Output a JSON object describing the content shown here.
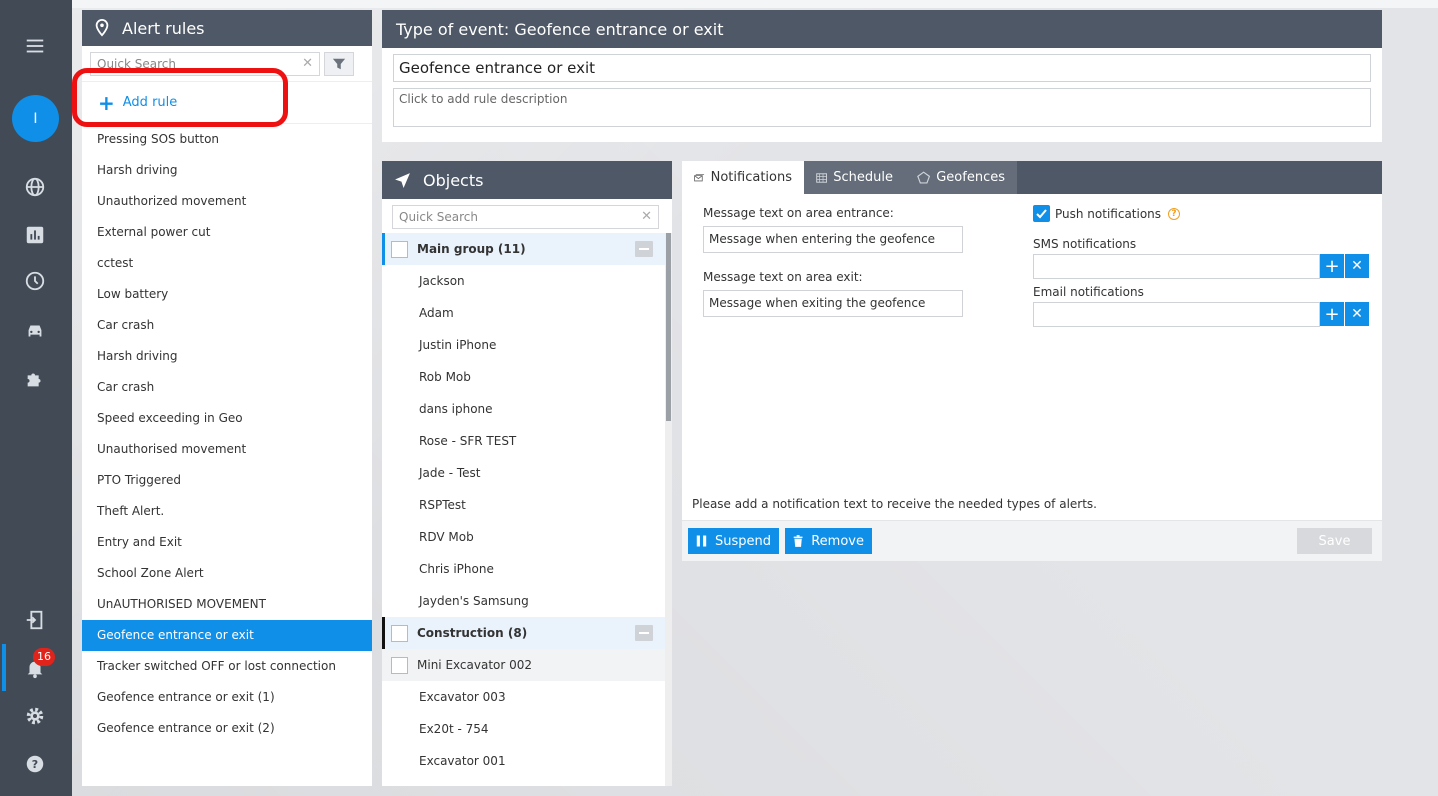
{
  "nav": {
    "avatar_initial": "I",
    "notification_count": "16",
    "icons": [
      "menu-icon",
      "globe-icon",
      "chart-icon",
      "clock-icon",
      "car-icon",
      "puzzle-icon",
      "logout-icon",
      "bell-icon",
      "gear-icon",
      "help-icon"
    ]
  },
  "rules": {
    "title": "Alert rules",
    "search_placeholder": "Quick Search",
    "add_label": "Add rule",
    "items": [
      "Pressing SOS button",
      "Harsh driving",
      "Unauthorized movement",
      "External power cut",
      "cctest",
      "Low battery",
      "Car crash",
      "Harsh driving",
      "Car crash",
      "Speed exceeding in Geo",
      "Unauthorised movement",
      "PTO Triggered",
      "Theft Alert.",
      "Entry and Exit",
      "School Zone Alert",
      "UnAUTHORISED MOVEMENT",
      "Geofence entrance or exit",
      "Tracker switched OFF or lost connection",
      "Geofence entrance or exit (1)",
      "Geofence entrance or exit (2)"
    ],
    "active_index": 16
  },
  "event": {
    "title": "Type of event: Geofence entrance or exit",
    "name": "Geofence entrance or exit",
    "description_placeholder": "Click to add rule description"
  },
  "objects": {
    "title": "Objects",
    "search_placeholder": "Quick Search",
    "groups": [
      {
        "name": "Main group (11)",
        "items": [
          "Jackson",
          "Adam",
          "Justin iPhone",
          "Rob Mob",
          "dans iphone",
          "Rose - SFR TEST",
          "Jade - Test",
          "RSPTest",
          "RDV Mob",
          "Chris iPhone",
          "Jayden's Samsung"
        ]
      },
      {
        "name": "Construction (8)",
        "items": [
          "Mini Excavator 002",
          "Excavator 003",
          "Ex20t - 754",
          "Excavator 001"
        ]
      }
    ]
  },
  "notifications": {
    "tabs": [
      "Notifications",
      "Schedule",
      "Geofences"
    ],
    "entrance_label": "Message text on area entrance:",
    "entrance_value": "Message when entering the geofence",
    "exit_label": "Message text on area exit:",
    "exit_value": "Message when exiting the geofence",
    "push_label": "Push notifications",
    "help_mark": "?",
    "sms_label": "SMS notifications",
    "email_label": "Email notifications",
    "hint": "Please add a notification text to receive the needed types of alerts.",
    "suspend_label": "Suspend",
    "remove_label": "Remove",
    "save_label": "Save"
  },
  "colors": {
    "accent": "#0f8fe8",
    "header": "#4e5866",
    "sidebar": "#414a55",
    "badge": "#e1241b",
    "highlight": "#ee1111"
  }
}
